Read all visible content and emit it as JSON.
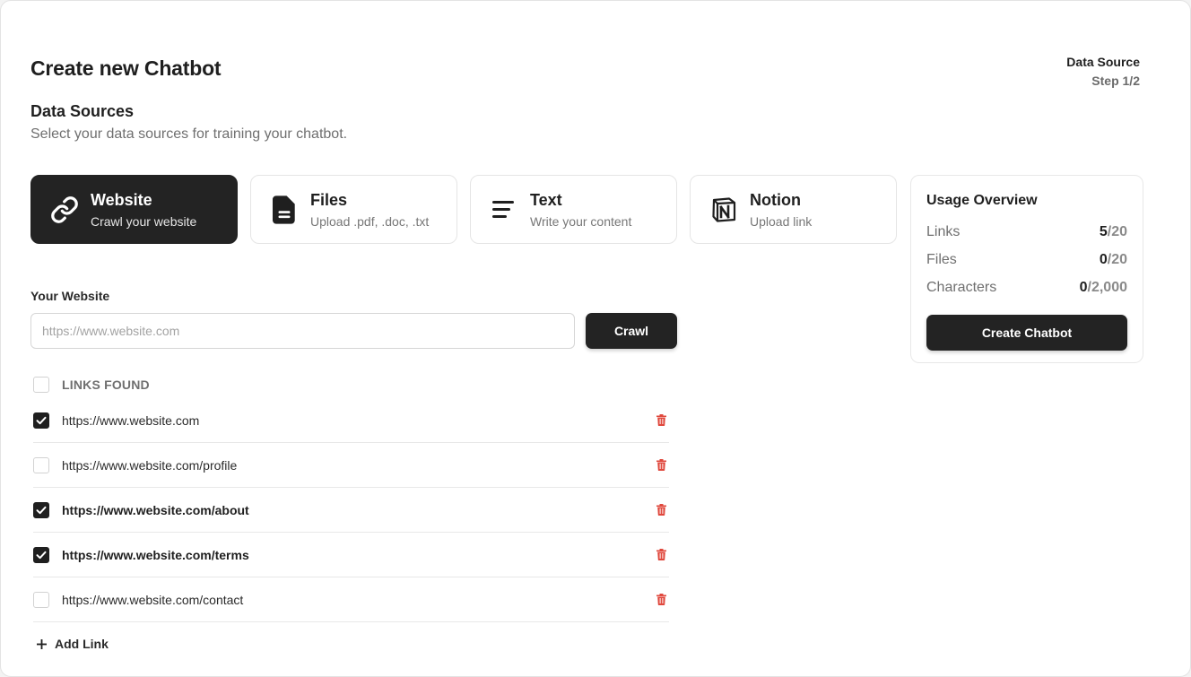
{
  "header": {
    "title": "Create new Chatbot",
    "step_label": "Data Source",
    "step_count": "Step 1/2"
  },
  "section": {
    "title": "Data Sources",
    "subtitle": "Select your data sources for training your chatbot."
  },
  "sources": [
    {
      "title": "Website",
      "subtitle": "Crawl your website",
      "icon": "link-icon",
      "active": true
    },
    {
      "title": "Files",
      "subtitle": "Upload .pdf, .doc, .txt",
      "icon": "file-icon",
      "active": false
    },
    {
      "title": "Text",
      "subtitle": "Write your content",
      "icon": "text-lines-icon",
      "active": false
    },
    {
      "title": "Notion",
      "subtitle": "Upload link",
      "icon": "notion-icon",
      "active": false
    }
  ],
  "usage": {
    "title": "Usage Overview",
    "rows": [
      {
        "label": "Links",
        "used": "5",
        "limit": "/20"
      },
      {
        "label": "Files",
        "used": "0",
        "limit": "/20"
      },
      {
        "label": "Characters",
        "used": "0",
        "limit": "/2,000"
      }
    ],
    "button": "Create Chatbot"
  },
  "website": {
    "label": "Your Website",
    "placeholder": "https://www.website.com",
    "value": "",
    "button": "Crawl"
  },
  "links": {
    "header": "LINKS FOUND",
    "header_checked": false,
    "items": [
      {
        "url": "https://www.website.com",
        "checked": true,
        "bold": false
      },
      {
        "url": "https://www.website.com/profile",
        "checked": false,
        "bold": false
      },
      {
        "url": "https://www.website.com/about",
        "checked": true,
        "bold": true
      },
      {
        "url": "https://www.website.com/terms",
        "checked": true,
        "bold": true
      },
      {
        "url": "https://www.website.com/contact",
        "checked": false,
        "bold": false
      }
    ],
    "add_label": "Add Link"
  },
  "colors": {
    "primary": "#232323",
    "danger": "#e0483d",
    "muted": "#6f6f6f",
    "border": "#e5e5e5"
  }
}
